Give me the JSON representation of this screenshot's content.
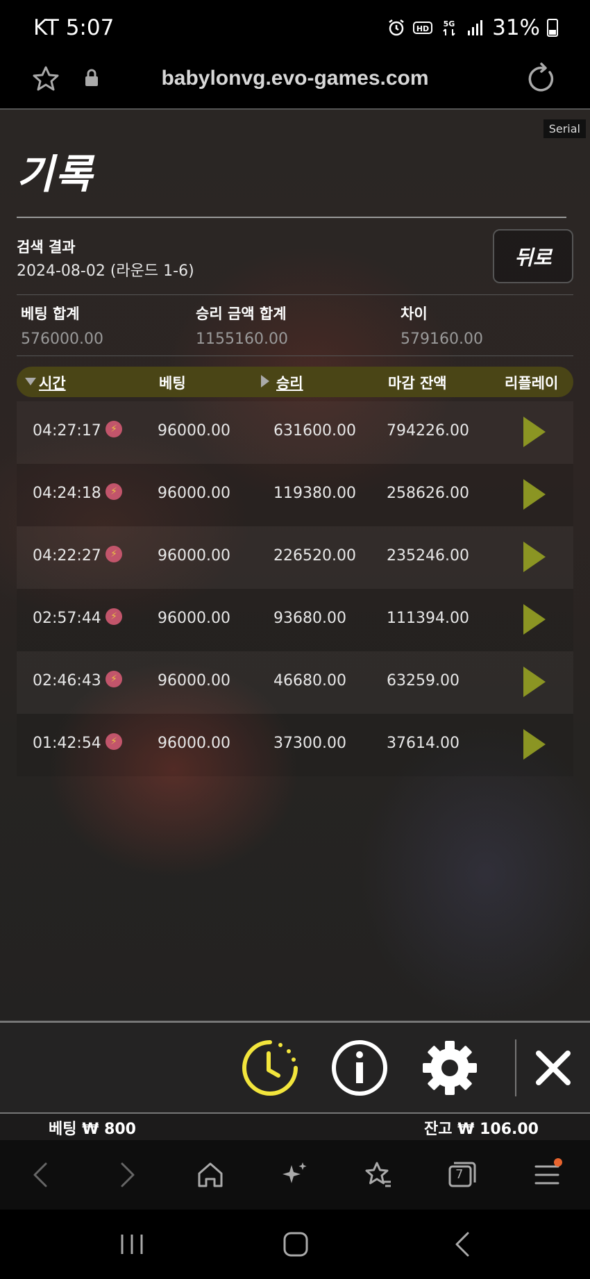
{
  "status_bar": {
    "carrier_time": "KT 5:07",
    "battery": "31%"
  },
  "url_bar": {
    "url": "babylonvg.evo-games.com"
  },
  "page": {
    "serial_tag": "Serial",
    "title": "기록",
    "search_label": "검색 결과",
    "search_value": "2024-08-02 (라운드 1-6)",
    "back_button": "뒤로"
  },
  "summary": {
    "bet_total_label": "베팅 합계",
    "bet_total_value": "576000.00",
    "win_total_label": "승리 금액 합계",
    "win_total_value": "1155160.00",
    "diff_label": "차이",
    "diff_value": "579160.00"
  },
  "table": {
    "headers": {
      "time": "시간",
      "bet": "베팅",
      "win": "승리",
      "closing_balance": "마감 잔액",
      "replay": "리플레이"
    },
    "rows": [
      {
        "time": "04:27:17",
        "bet": "96000.00",
        "win": "631600.00",
        "balance": "794226.00"
      },
      {
        "time": "04:24:18",
        "bet": "96000.00",
        "win": "119380.00",
        "balance": "258626.00"
      },
      {
        "time": "04:22:27",
        "bet": "96000.00",
        "win": "226520.00",
        "balance": "235246.00"
      },
      {
        "time": "02:57:44",
        "bet": "96000.00",
        "win": "93680.00",
        "balance": "111394.00"
      },
      {
        "time": "02:46:43",
        "bet": "96000.00",
        "win": "46680.00",
        "balance": "63259.00"
      },
      {
        "time": "01:42:54",
        "bet": "96000.00",
        "win": "37300.00",
        "balance": "37614.00"
      }
    ]
  },
  "footer": {
    "bet_label": "베팅 ₩ 800",
    "balance_label": "잔고 ₩ 106.00"
  },
  "browser_nav": {
    "tabs_count": "7"
  },
  "colors": {
    "accent_yellow": "#f2e53c",
    "play_olive": "#8b9523",
    "header_olive": "#4a4516",
    "lightning_badge": "#c2556b",
    "notification_dot": "#e8642e"
  }
}
